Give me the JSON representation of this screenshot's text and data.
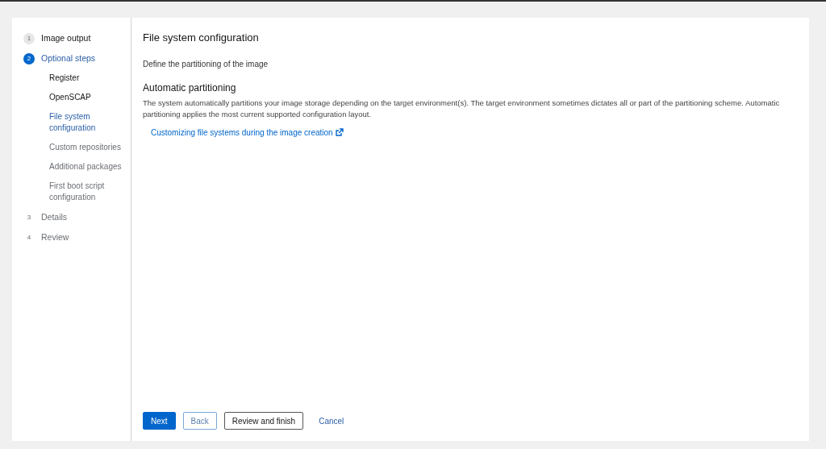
{
  "steps": [
    {
      "number": "1",
      "label": "Image output",
      "selected": false,
      "visited": true
    },
    {
      "number": "2",
      "label": "Optional steps",
      "selected": true,
      "visited": true,
      "children": [
        {
          "label": "Register",
          "selected": false,
          "visited": true
        },
        {
          "label": "OpenSCAP",
          "selected": false,
          "visited": true
        },
        {
          "label": "File system configuration",
          "selected": true,
          "visited": true
        },
        {
          "label": "Custom repositories",
          "selected": false,
          "visited": false
        },
        {
          "label": "Additional packages",
          "selected": false,
          "visited": false
        },
        {
          "label": "First boot script configuration",
          "selected": false,
          "visited": false
        }
      ]
    },
    {
      "number": "3",
      "label": "Details",
      "selected": false,
      "visited": false
    },
    {
      "number": "4",
      "label": "Review",
      "selected": false,
      "visited": false
    }
  ],
  "content": {
    "title": "File system configuration",
    "description": "Define the partitioning of the image",
    "section_title": "Automatic partitioning",
    "section_text": "The system automatically partitions your image storage depending on the target environment(s). The target environment sometimes dictates all or part of the partitioning scheme. Automatic partitioning applies the most current supported configuration layout.",
    "link": "Customizing file systems during the image creation"
  },
  "buttons": [
    {
      "kind": "primary",
      "label": "Next"
    },
    {
      "kind": "secondary",
      "label": "Back"
    },
    {
      "kind": "tertiary",
      "label": "Review and finish"
    },
    {
      "kind": "link",
      "label": "Cancel"
    }
  ]
}
